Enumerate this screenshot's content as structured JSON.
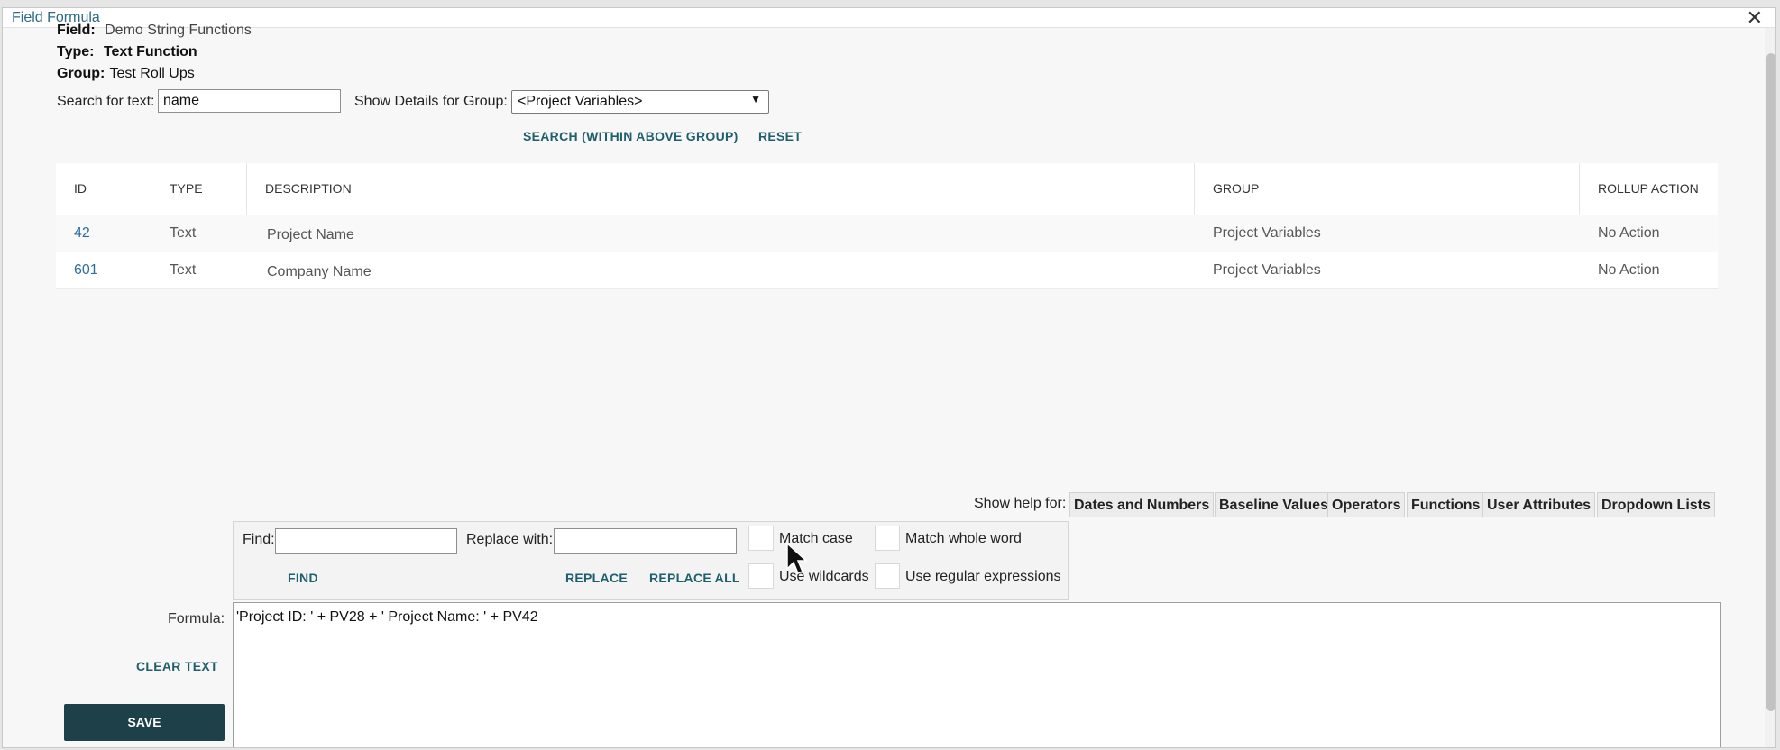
{
  "window": {
    "title": "Field Formula",
    "close_glyph": "✕"
  },
  "info": {
    "field_label": "Field:",
    "field_value": "Demo String Functions",
    "type_label": "Type:",
    "type_value": "Text Function",
    "group_label": "Group:",
    "group_value": "Test Roll Ups"
  },
  "search": {
    "label": "Search for text:",
    "value": "name",
    "group_label": "Show Details for Group:",
    "group_selected": "<Project Variables>",
    "search_button": "SEARCH (WITHIN ABOVE GROUP)",
    "reset_button": "RESET"
  },
  "table": {
    "columns": [
      "ID",
      "TYPE",
      "DESCRIPTION",
      "GROUP",
      "ROLLUP ACTION"
    ],
    "rows": [
      {
        "id": "42",
        "type": "Text",
        "description": "Project Name",
        "group": "Project Variables",
        "rollup": "No Action"
      },
      {
        "id": "601",
        "type": "Text",
        "description": "Company Name",
        "group": "Project Variables",
        "rollup": "No Action"
      }
    ]
  },
  "help": {
    "label": "Show help for:",
    "buttons": [
      "Dates and Numbers",
      "Baseline Values",
      "Operators",
      "Functions",
      "User Attributes",
      "Dropdown Lists"
    ]
  },
  "find_replace": {
    "find_label": "Find:",
    "find_value": "",
    "replace_label": "Replace with:",
    "replace_value": "",
    "find_button": "FIND",
    "replace_button": "REPLACE",
    "replace_all_button": "REPLACE ALL",
    "match_case": "Match case",
    "match_whole_word": "Match whole word",
    "use_wildcards": "Use wildcards",
    "use_regex": "Use regular expressions"
  },
  "formula": {
    "label": "Formula:",
    "value": "'Project ID: ' + PV28 + ' Project Name: ' + PV42",
    "clear_button": "CLEAR TEXT"
  },
  "save_button": "SAVE",
  "colors": {
    "accent": "#1f5e6b",
    "save_bg": "#1e4149",
    "link": "#2c6d9e"
  },
  "icons": {
    "close": "close-icon",
    "dropdown": "chevron-down-icon",
    "cursor": "mouse-pointer-icon"
  }
}
